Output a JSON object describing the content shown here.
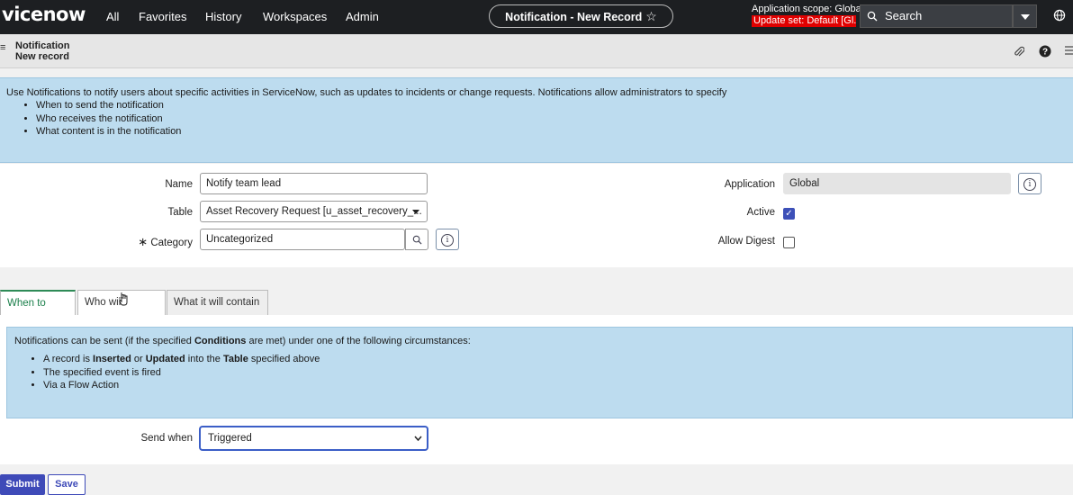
{
  "topbar": {
    "logo": "vicenow",
    "nav": [
      "All",
      "Favorites",
      "History",
      "Workspaces",
      "Admin"
    ],
    "record_pill": "Notification - New Record",
    "scope_line1": "Application scope: Global",
    "scope_line2": "Update set: Default [Gl...",
    "search_placeholder": "Search"
  },
  "header": {
    "title": "Notification",
    "subtitle": "New record"
  },
  "info": {
    "intro": "Use Notifications to notify users about specific activities in ServiceNow, such as updates to incidents or change requests. Notifications allow administrators to specify",
    "bullets": [
      "When to send the notification",
      "Who receives the notification",
      "What content is in the notification"
    ]
  },
  "form": {
    "name_label": "Name",
    "name_value": "Notify team lead",
    "table_label": "Table",
    "table_value": "Asset Recovery Request [u_asset_recovery_...",
    "category_required": "∗",
    "category_label": "Category",
    "category_value": "Uncategorized",
    "application_label": "Application",
    "application_value": "Global",
    "active_label": "Active",
    "active_checked": true,
    "allow_digest_label": "Allow Digest",
    "allow_digest_checked": false
  },
  "tabs": [
    "When to send",
    "Who will receive",
    "What it will contain"
  ],
  "when_to_send": {
    "intro_before": "Notifications can be sent (if the specified ",
    "intro_bold": "Conditions",
    "intro_after": " are met) under one of the following circumstances:",
    "b1_pre": "A record is ",
    "b1_bold1": "Inserted",
    "b1_mid": " or ",
    "b1_bold2": "Updated",
    "b1_mid2": " into the ",
    "b1_bold3": "Table",
    "b1_post": " specified above",
    "b2": "The specified event is fired",
    "b3": "Via a Flow Action",
    "send_when_label": "Send when",
    "send_when_value": "Triggered"
  },
  "buttons": {
    "submit": "Submit",
    "save": "Save"
  },
  "colors": {
    "topbar": "#1d1f22",
    "info_bg": "#bddcef",
    "accent": "#3e4ab8",
    "active_tab": "#2e8b57",
    "update_set": "#e00000"
  }
}
